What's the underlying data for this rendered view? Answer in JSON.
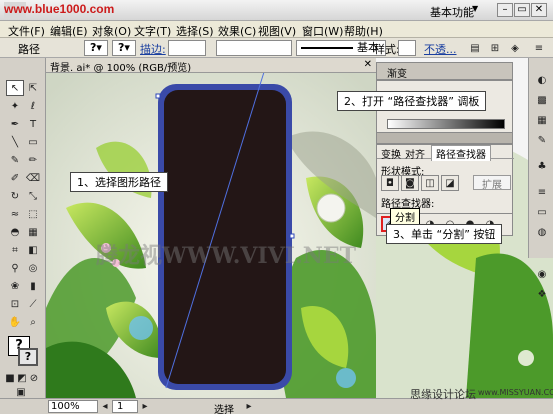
{
  "titlebar": {
    "watermark": "www.blue1000.com",
    "workspace_label": "基本功能",
    "min_label": "–",
    "restore_label": "▭",
    "close_label": "✕"
  },
  "menu": [
    "文件(F)",
    "编辑(E)",
    "对象(O)",
    "文字(T)",
    "选择(S)",
    "效果(C)",
    "视图(V)",
    "窗口(W)",
    "帮助(H)"
  ],
  "controlbar": {
    "object_type": "路径",
    "stroke_label": "描边:",
    "brush_style": "基本",
    "style_label": "样式:",
    "opacity_label": "不透..."
  },
  "document": {
    "tab_title": "背景. ai* @ 100% (RGB/预览)"
  },
  "panels": {
    "gradient_title": "渐变",
    "tabs": [
      "变换",
      "对齐",
      "路径查找器"
    ],
    "shape_modes_label": "形状模式:",
    "expand_label": "扩展",
    "pathfinder_label": "路径查找器:",
    "tooltip": "分割"
  },
  "callouts": {
    "step1": "1、选择图形路径",
    "step2": "2、打开 “路径查找器” 调板",
    "step3": "3、单击 “分割” 按钮"
  },
  "status": {
    "zoom": "100%",
    "page": "1",
    "tool": "选择"
  },
  "watermarks": {
    "center": "腾龙视WWW.VIVI.NET",
    "bottom_cn": "思缘设计论坛",
    "bottom_url": "www.MISSYUAN.COM"
  },
  "colors": {
    "phone_body": "#231616",
    "phone_rim": "#3a4aa8",
    "highlight_red": "#e02020"
  },
  "icons": {
    "tool1": "selection-arrow-icon",
    "tool2": "direct-selection-icon"
  }
}
